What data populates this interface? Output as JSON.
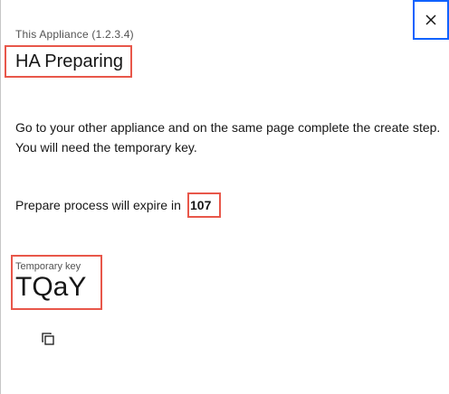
{
  "header": {
    "subtitle": "This Appliance (1.2.3.4)",
    "title": "HA Preparing",
    "close_icon": "close-icon"
  },
  "body": {
    "description": "Go to your other appliance and on the same page complete the create step. You will need the temporary key.",
    "expire_text": "Prepare process will expire in",
    "expire_value": "107"
  },
  "key": {
    "label": "Temporary key",
    "value": "TQaY",
    "copy_icon": "copy-icon"
  },
  "colors": {
    "accent": "#0f62fe",
    "highlight": "#e8574a",
    "text": "#161616",
    "secondary_text": "#525252"
  }
}
